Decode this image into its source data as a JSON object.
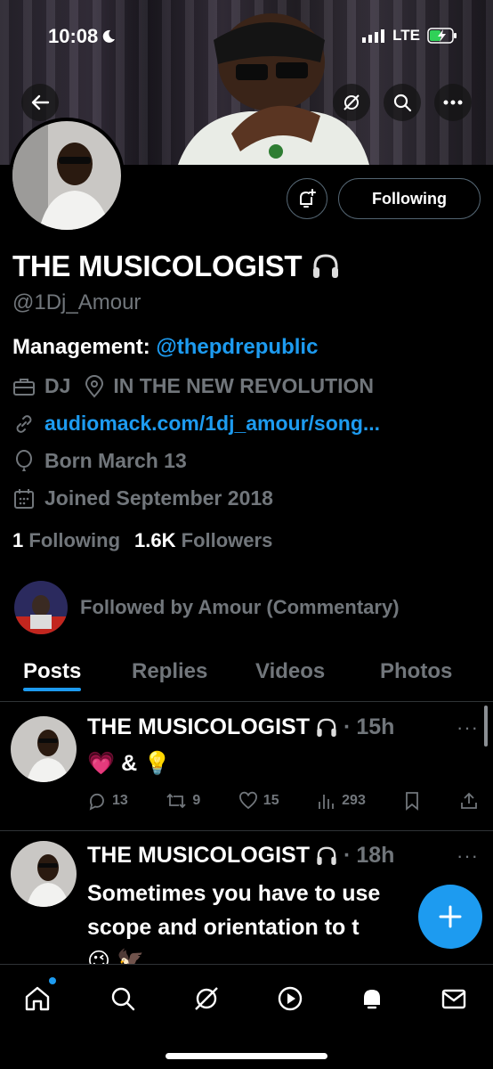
{
  "status": {
    "time": "10:08",
    "network": "LTE"
  },
  "profile": {
    "name": "THE MUSICOLOGIST",
    "handle": "@1Dj_Amour",
    "bio_label": "Management:",
    "bio_mention": "@thepdrepublic",
    "category": "DJ",
    "location": "IN THE NEW REVOLUTION",
    "website": "audiomack.com/1dj_amour/song...",
    "born": "Born March 13",
    "joined": "Joined September 2018",
    "following_count": "1",
    "following_label": "Following",
    "followers_count": "1.6K",
    "followers_label": "Followers",
    "followed_by": "Followed by Amour (Commentary)",
    "follow_button": "Following"
  },
  "tabs": [
    {
      "label": "Posts",
      "active": true
    },
    {
      "label": "Replies",
      "active": false
    },
    {
      "label": "Videos",
      "active": false
    },
    {
      "label": "Photos",
      "active": false
    }
  ],
  "posts": [
    {
      "author": "THE MUSICOLOGIST",
      "time": "15h",
      "text": "💗 & 💡",
      "replies": "13",
      "reposts": "9",
      "likes": "15",
      "views": "293"
    },
    {
      "author": "THE MUSICOLOGIST",
      "time": "18h",
      "line1": "Sometimes you have to use",
      "line2": "scope and orientation to t",
      "line3": "😉 🦅"
    }
  ],
  "colors": {
    "accent": "#1d9bf0",
    "muted": "#71767b",
    "background": "#000000"
  },
  "icons": [
    "back-arrow-icon",
    "grok-icon",
    "search-icon",
    "more-icon",
    "bell-plus-icon",
    "headphones-icon",
    "briefcase-icon",
    "location-pin-icon",
    "link-icon",
    "balloon-icon",
    "calendar-icon",
    "reply-icon",
    "repost-icon",
    "heart-icon",
    "views-icon",
    "bookmark-icon",
    "share-icon",
    "compose-plus-icon",
    "home-icon",
    "explore-icon",
    "grok-nav-icon",
    "video-icon",
    "notifications-icon",
    "messages-icon"
  ]
}
